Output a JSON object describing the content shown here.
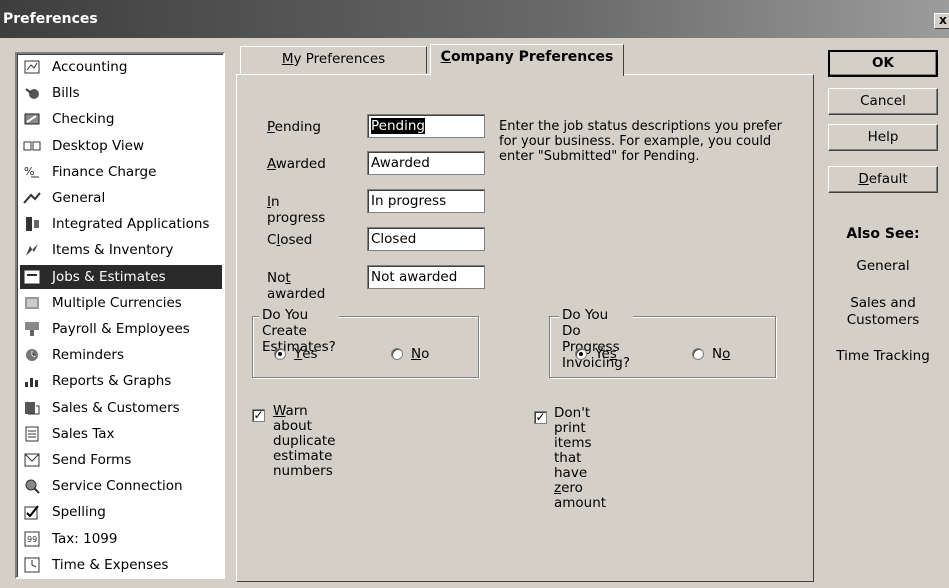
{
  "window": {
    "title": "Preferences",
    "close_glyph": "x"
  },
  "sidebar": {
    "items": [
      {
        "label": "Accounting",
        "icon": "accounting-icon"
      },
      {
        "label": "Bills",
        "icon": "bills-icon"
      },
      {
        "label": "Checking",
        "icon": "checking-icon"
      },
      {
        "label": "Desktop View",
        "icon": "desktop-view-icon"
      },
      {
        "label": "Finance Charge",
        "icon": "finance-charge-icon"
      },
      {
        "label": "General",
        "icon": "general-icon"
      },
      {
        "label": "Integrated Applications",
        "icon": "integrated-apps-icon"
      },
      {
        "label": "Items & Inventory",
        "icon": "items-inventory-icon"
      },
      {
        "label": "Jobs & Estimates",
        "icon": "jobs-estimates-icon",
        "selected": true
      },
      {
        "label": "Multiple Currencies",
        "icon": "currencies-icon"
      },
      {
        "label": "Payroll & Employees",
        "icon": "payroll-icon"
      },
      {
        "label": "Reminders",
        "icon": "reminders-icon"
      },
      {
        "label": "Reports & Graphs",
        "icon": "reports-icon"
      },
      {
        "label": "Sales & Customers",
        "icon": "sales-icon"
      },
      {
        "label": "Sales Tax",
        "icon": "sales-tax-icon"
      },
      {
        "label": "Send Forms",
        "icon": "send-forms-icon"
      },
      {
        "label": "Service Connection",
        "icon": "service-connection-icon"
      },
      {
        "label": "Spelling",
        "icon": "spelling-icon"
      },
      {
        "label": "Tax: 1099",
        "icon": "tax-icon"
      },
      {
        "label": "Time & Expenses",
        "icon": "time-expenses-icon"
      }
    ]
  },
  "tabs": {
    "my_preferences": {
      "pre": "",
      "u": "M",
      "post": "y Preferences"
    },
    "company_preferences": {
      "pre": "",
      "u": "C",
      "post": "ompany Preferences"
    }
  },
  "job_status": {
    "pending": {
      "label_u": "P",
      "label_rest": "ending",
      "value": "Pending"
    },
    "awarded": {
      "label_u": "A",
      "label_rest": "warded",
      "value": "Awarded"
    },
    "in_progress": {
      "label_u": "I",
      "label_rest": "n progress",
      "value": "In progress"
    },
    "closed": {
      "label_pre": "C",
      "label_u": "l",
      "label_rest": "osed",
      "value": "Closed"
    },
    "not_awarded": {
      "label_pre": "No",
      "label_u": "t",
      "label_rest": " awarded",
      "value": "Not awarded"
    },
    "help_text": "Enter the job status descriptions you prefer for your business.  For example, you could enter \"Submitted\" for Pending."
  },
  "estimates_group": {
    "title": "Do You Create Estimates?",
    "yes": {
      "u": "Y",
      "rest": "es",
      "selected": true
    },
    "no": {
      "u": "N",
      "rest": "o",
      "selected": false
    }
  },
  "progress_group": {
    "title": "Do You Do Progress Invoicing?",
    "yes": {
      "pre": "Ye",
      "u": "s",
      "rest": "",
      "selected": true
    },
    "no": {
      "pre": "N",
      "u": "o",
      "rest": "",
      "selected": false
    }
  },
  "checkboxes": {
    "warn_duplicate": {
      "u": "W",
      "line1_rest": "arn about duplicate estimate",
      "line2": "numbers",
      "checked": true
    },
    "dont_print_zero": {
      "line1_pre": "Don't print items that have ",
      "u": "z",
      "line1_rest": "ero",
      "line2": "amount",
      "checked": true
    }
  },
  "buttons": {
    "ok": "OK",
    "cancel": "Cancel",
    "help": "Help",
    "default": {
      "u": "D",
      "rest": "efault"
    }
  },
  "also_see": {
    "title": "Also See:",
    "links": [
      "General",
      "Sales and Customers",
      "Time Tracking"
    ]
  }
}
